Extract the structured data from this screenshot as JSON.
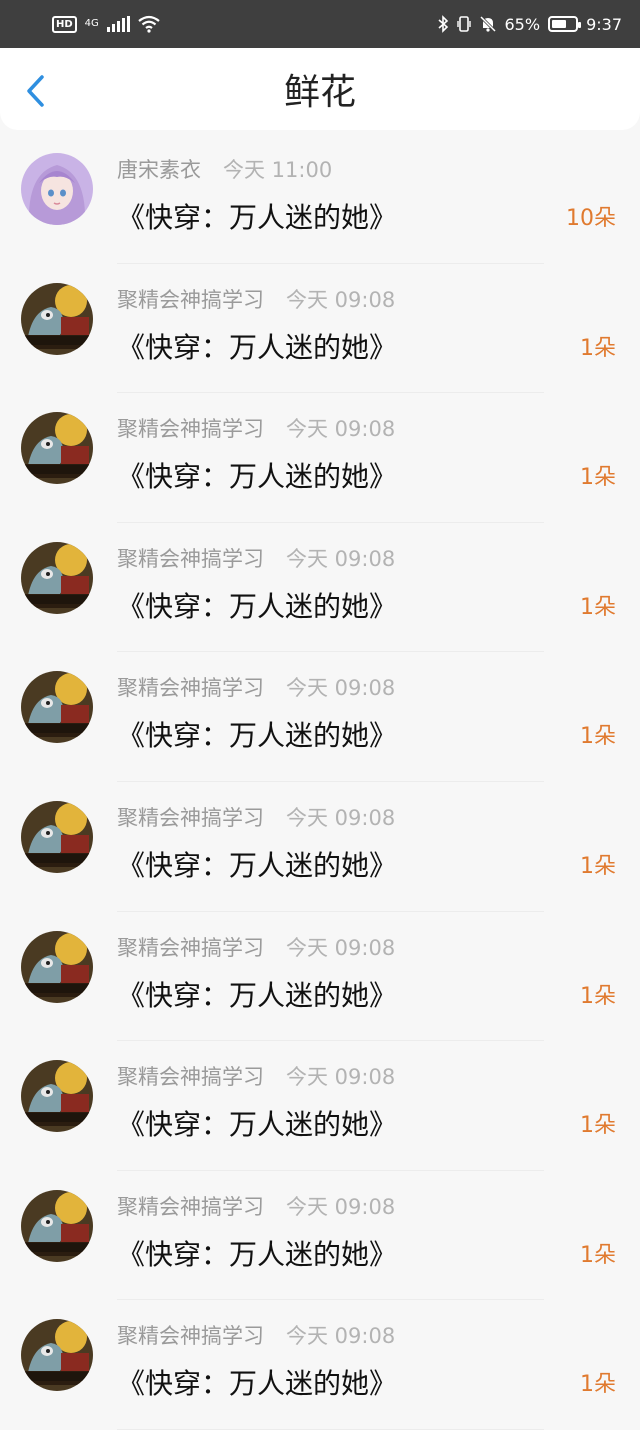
{
  "status_bar": {
    "hd": "HD",
    "network": "4G",
    "battery_percent": "65%",
    "time": "9:37",
    "battery_level": 0.65
  },
  "header": {
    "title": "鲜花",
    "back_icon": "chevron-left-icon",
    "accent_color": "#2f8fe0"
  },
  "items": [
    {
      "user": "唐宋素衣",
      "time": "今天 11:00",
      "book": "《快穿：万人迷的她》",
      "count": "10朵",
      "avatar": "girl"
    },
    {
      "user": "聚精会神搞学习",
      "time": "今天 09:08",
      "book": "《快穿：万人迷的她》",
      "count": "1朵",
      "avatar": "cartoon"
    },
    {
      "user": "聚精会神搞学习",
      "time": "今天 09:08",
      "book": "《快穿：万人迷的她》",
      "count": "1朵",
      "avatar": "cartoon"
    },
    {
      "user": "聚精会神搞学习",
      "time": "今天 09:08",
      "book": "《快穿：万人迷的她》",
      "count": "1朵",
      "avatar": "cartoon"
    },
    {
      "user": "聚精会神搞学习",
      "time": "今天 09:08",
      "book": "《快穿：万人迷的她》",
      "count": "1朵",
      "avatar": "cartoon"
    },
    {
      "user": "聚精会神搞学习",
      "time": "今天 09:08",
      "book": "《快穿：万人迷的她》",
      "count": "1朵",
      "avatar": "cartoon"
    },
    {
      "user": "聚精会神搞学习",
      "time": "今天 09:08",
      "book": "《快穿：万人迷的她》",
      "count": "1朵",
      "avatar": "cartoon"
    },
    {
      "user": "聚精会神搞学习",
      "time": "今天 09:08",
      "book": "《快穿：万人迷的她》",
      "count": "1朵",
      "avatar": "cartoon"
    },
    {
      "user": "聚精会神搞学习",
      "time": "今天 09:08",
      "book": "《快穿：万人迷的她》",
      "count": "1朵",
      "avatar": "cartoon"
    },
    {
      "user": "聚精会神搞学习",
      "time": "今天 09:08",
      "book": "《快穿：万人迷的她》",
      "count": "1朵",
      "avatar": "cartoon"
    }
  ],
  "colors": {
    "count": "#e07a2f",
    "name": "#9a9a9a",
    "status_bar_bg": "#3f3f3f"
  }
}
